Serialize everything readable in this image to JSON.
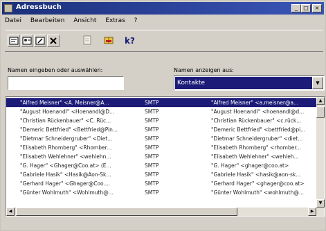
{
  "window": {
    "title": "Adressbuch",
    "minimize": "_",
    "maximize": "□",
    "close": "×"
  },
  "menu": [
    "Datei",
    "Bearbeiten",
    "Ansicht",
    "Extras",
    "?"
  ],
  "toolbar": {
    "icons": [
      "properties-icon",
      "new-contact-icon",
      "delete-icon",
      "find-icon",
      "open-book-icon",
      "help-icon"
    ]
  },
  "search": {
    "label": "Namen eingeben oder auswählen:",
    "value": ""
  },
  "source": {
    "label": "Namen anzeigen aus:",
    "selected": "Kontakte"
  },
  "contacts": [
    {
      "name": "\"Alfred Meisner\" <A. Meisner@A...",
      "type": "SMTP",
      "display": "\"Alfred Meisner\" <a.meisner@a..."
    },
    {
      "name": "\"August Hoenandl\" <Hoenandl@D...",
      "type": "SMTP",
      "display": "\"August Hoenandl\" <hoenandl@d..."
    },
    {
      "name": "\"Christian Rückenbauer\" <C. Rüc...",
      "type": "SMTP",
      "display": "\"Christian Rückenbauer\" <c.rück..."
    },
    {
      "name": "\"Demeric Bettfried\" <Bettfried@Pin...",
      "type": "SMTP",
      "display": "\"Demeric Bettfried\" <bettfried@pi..."
    },
    {
      "name": "\"Dietmar Schneidergruber\" <Diet...",
      "type": "SMTP",
      "display": "\"Dietmar Schneidergruber\" <diet..."
    },
    {
      "name": "\"Elisabeth Rhomberg\" <Rhomber...",
      "type": "SMTP",
      "display": "\"Elisabeth Rhomberg\" <rhomber..."
    },
    {
      "name": "\"Elisabeth Wehlehner\" <wehlehn...",
      "type": "SMTP",
      "display": "\"Elisabeth Wehlehner\" <wehleh..."
    },
    {
      "name": "\"G. Hager\" <Ghager@Coo.at> (E...",
      "type": "SMTP",
      "display": "\"G. Hager\" <ghager@coo.at>"
    },
    {
      "name": "\"Gabriele Hasik\" <Hasik@Aon-Sk...",
      "type": "SMTP",
      "display": "\"Gabriele Hasik\" <hasik@aon-sk..."
    },
    {
      "name": "\"Gerhard Hager\" <Ghager@Coo....",
      "type": "SMTP",
      "display": "\"Gerhard Hager\" <ghager@coo.at>"
    },
    {
      "name": "\"Günter Wohlmuth\" <Wohlmuth@...",
      "type": "SMTP",
      "display": "\"Günter Wohlmuth\" <wohlmuth@..."
    }
  ]
}
